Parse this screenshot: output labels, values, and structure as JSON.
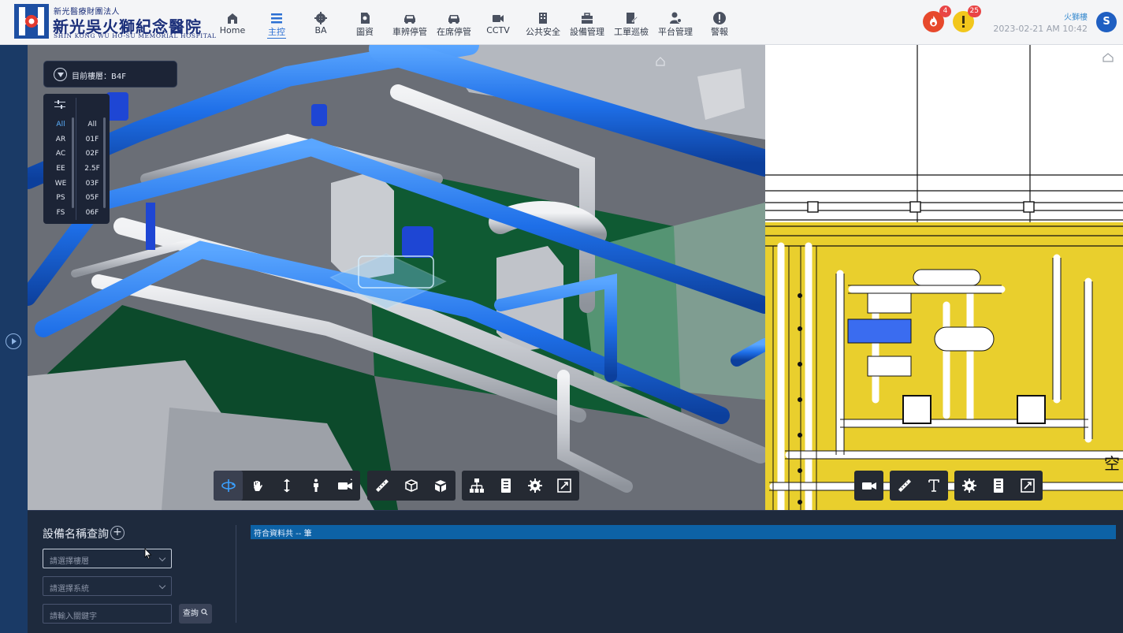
{
  "header": {
    "logo": {
      "org_small": "新光醫療財團法人",
      "name": "新光吳火獅紀念醫院",
      "name_en": "SHIN KONG WU HO-SU MEMORIAL HOSPITAL"
    },
    "nav": [
      {
        "label": "Home",
        "icon": "house-icon"
      },
      {
        "label": "主控",
        "icon": "menu-icon",
        "active": true
      },
      {
        "label": "BA",
        "icon": "gear-icon"
      },
      {
        "label": "圖資",
        "icon": "map-icon"
      },
      {
        "label": "車辨停管",
        "icon": "car-icon"
      },
      {
        "label": "在席停管",
        "icon": "car-icon"
      },
      {
        "label": "CCTV",
        "icon": "camera-icon"
      },
      {
        "label": "公共安全",
        "icon": "building-icon"
      },
      {
        "label": "設備管理",
        "icon": "toolbox-icon"
      },
      {
        "label": "工單巡檢",
        "icon": "edit-icon"
      },
      {
        "label": "平台管理",
        "icon": "user-gear-icon"
      },
      {
        "label": "警報",
        "icon": "alert-icon"
      }
    ],
    "fire_alert_count": "4",
    "warning_count": "25",
    "fire_building": "火獅樓",
    "datetime": "2023-02-21 AM 10:42",
    "user_initial": "S"
  },
  "viewer3d": {
    "current_floor": "目前樓層：B4F",
    "systems": [
      "All",
      "AR",
      "AC",
      "EE",
      "WE",
      "PS",
      "FS"
    ],
    "floors": [
      "All",
      "01F",
      "02F",
      "2.5F",
      "03F",
      "05F",
      "06F"
    ],
    "toolbar": [
      "orbit-icon",
      "pan-icon",
      "zoom-icon",
      "first-person-icon",
      "camera-icon",
      "measure-icon",
      "section-box-icon",
      "explode-icon",
      "model-tree-icon",
      "properties-icon",
      "settings-icon",
      "fullscreen-icon"
    ]
  },
  "viewer2d": {
    "toolbar": [
      "camera-icon",
      "measure-icon",
      "text-icon",
      "settings-icon",
      "properties-icon",
      "fullscreen-icon"
    ],
    "corner_char": "空"
  },
  "query": {
    "title": "設備名稱查詢",
    "add": "+",
    "floor_placeholder": "請選擇樓層",
    "system_placeholder": "請選擇系統",
    "keyword_placeholder": "請輸入關鍵字",
    "search_label": "查詢",
    "result_text": "符合資料共 -- 筆"
  },
  "colors": {
    "accent": "#2a6fd3",
    "pipe_blue": "#1e6fe8",
    "drawing_yellow": "#e9cf2d",
    "panel_dark": "#1e2a3d",
    "result_bar": "#0d62a6"
  }
}
